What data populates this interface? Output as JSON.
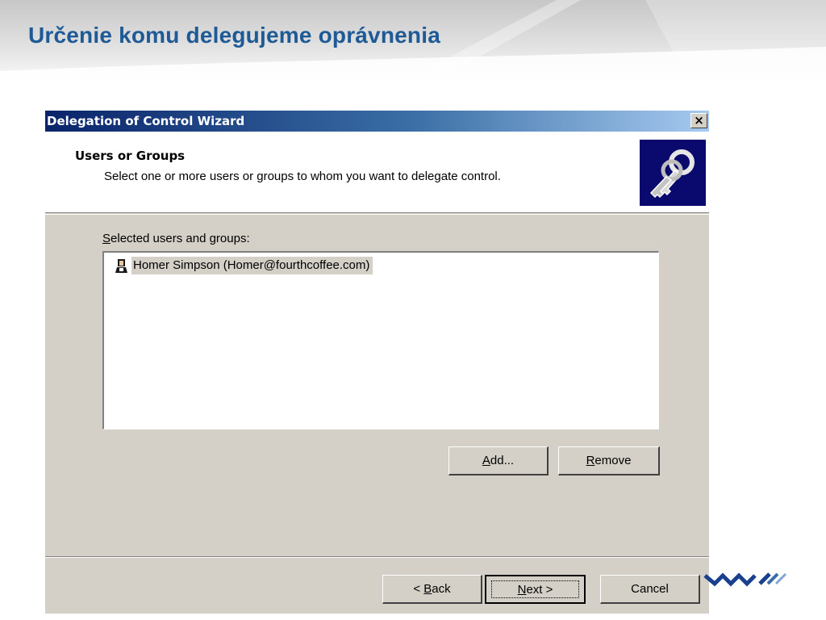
{
  "slide": {
    "title": "Určenie komu delegujeme oprávnenia"
  },
  "wizard": {
    "window_title": "Delegation of Control Wizard",
    "close_glyph": "×",
    "header_title": "Users or Groups",
    "header_subtitle": "Select one or more users or groups to whom you want to delegate control.",
    "header_icon": "keys-icon",
    "list_label_accesskey": "S",
    "list_label_rest": "elected users and groups:",
    "list_items": [
      {
        "icon": "user-icon",
        "label": "Homer Simpson (Homer@fourthcoffee.com)"
      }
    ],
    "buttons": {
      "add_accesskey": "A",
      "add_rest": "dd...",
      "remove_accesskey": "R",
      "remove_rest": "emove",
      "back_prefix": "< ",
      "back_accesskey": "B",
      "back_rest": "ack",
      "next_accesskey": "N",
      "next_rest": "ext >",
      "cancel": "Cancel"
    }
  },
  "colors": {
    "slide_title": "#1d5a96",
    "dialog_face": "#d4d0c8",
    "titlebar_start": "#0a246a",
    "titlebar_end": "#a6caf0",
    "logo_blue": "#1b3f8f"
  }
}
